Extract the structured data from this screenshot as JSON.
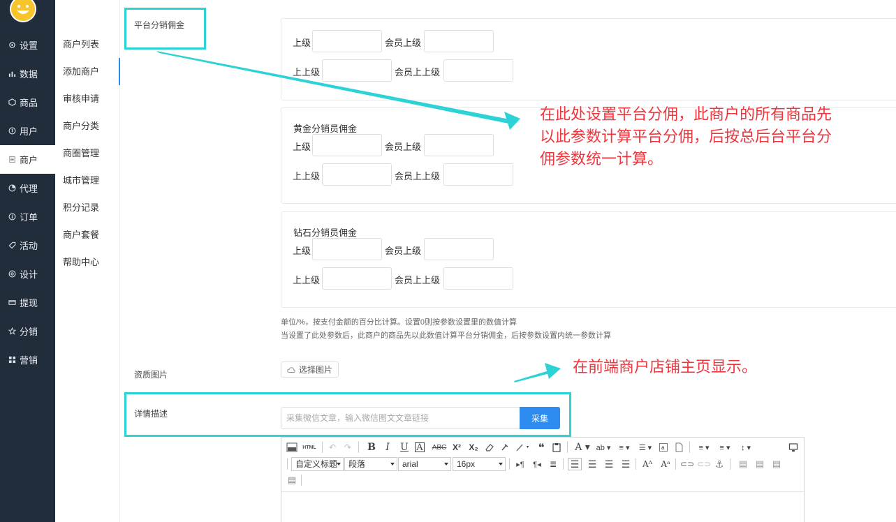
{
  "sidebar": {
    "items": [
      {
        "label": "设置"
      },
      {
        "label": "数据"
      },
      {
        "label": "商品"
      },
      {
        "label": "用户"
      },
      {
        "label": "商户"
      },
      {
        "label": "代理"
      },
      {
        "label": "订单"
      },
      {
        "label": "活动"
      },
      {
        "label": "设计"
      },
      {
        "label": "提现"
      },
      {
        "label": "分销"
      },
      {
        "label": "营销"
      }
    ]
  },
  "submenu": {
    "items": [
      {
        "label": "商户列表"
      },
      {
        "label": "添加商户"
      },
      {
        "label": "审核申请"
      },
      {
        "label": "商户分类"
      },
      {
        "label": "商圈管理"
      },
      {
        "label": "城市管理"
      },
      {
        "label": "积分记录"
      },
      {
        "label": "商户套餐"
      },
      {
        "label": "帮助中心"
      }
    ]
  },
  "form": {
    "commission_label": "平台分销佣金",
    "cards": [
      {
        "title": "",
        "upper": "上级",
        "member_upper": "会员上级",
        "upper2": "上上级",
        "member_upper2": "会员上上级"
      },
      {
        "title": "黄金分销员佣金",
        "upper": "上级",
        "member_upper": "会员上级",
        "upper2": "上上级",
        "member_upper2": "会员上上级"
      },
      {
        "title": "钻石分销员佣金",
        "upper": "上级",
        "member_upper": "会员上级",
        "upper2": "上上级",
        "member_upper2": "会员上上级"
      }
    ],
    "hint1": "单位/%，按支付金额的百分比计算。设置0则按参数设置里的数值计算",
    "hint2": "当设置了此处参数后，此商户的商品先以此数值计算平台分销佣金，后按参数设置内统一参数计算",
    "qualification_label": "资质图片",
    "select_image": "选择图片",
    "detail_label": "详情描述",
    "collect_placeholder": "采集微信文章，输入微信图文文章链接",
    "collect_button": "采集"
  },
  "editor": {
    "heading_select": "自定义标题",
    "paragraph_select": "段落",
    "font_select": "arial",
    "size_select": "16px",
    "html_label": "HTML"
  },
  "annotations": {
    "commission_note": [
      "在此处设置平台分佣，此商户的所有商品先",
      "以此参数计算平台分佣，后按总后台平台分",
      "佣参数统一计算。"
    ],
    "storefront_note": "在前端商户店铺主页显示。"
  },
  "colors": {
    "sidebar_bg": "#222d3c",
    "accent": "#2d8cf0",
    "annotation_box": "#2dd2d6",
    "annotation_text": "#f0353d"
  }
}
